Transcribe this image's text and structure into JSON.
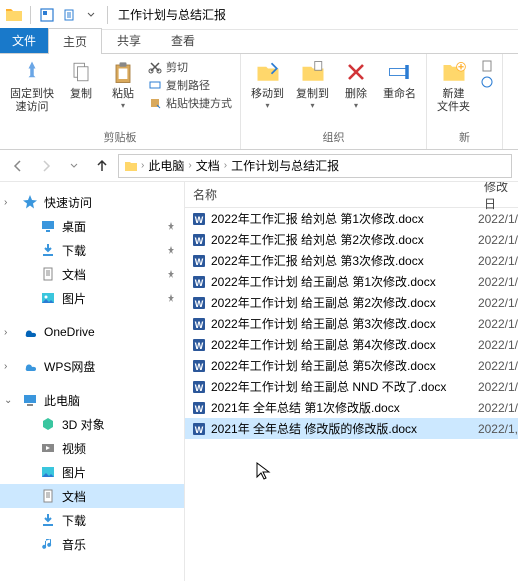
{
  "window": {
    "title": "工作计划与总结汇报"
  },
  "tabs": {
    "file": "文件",
    "home": "主页",
    "share": "共享",
    "view": "查看"
  },
  "ribbon": {
    "pin": "固定到快\n速访问",
    "copy": "复制",
    "paste": "粘贴",
    "cut": "剪切",
    "copy_path": "复制路径",
    "paste_shortcut": "粘贴快捷方式",
    "clipboard_group": "剪贴板",
    "move_to": "移动到",
    "copy_to": "复制到",
    "delete": "删除",
    "rename": "重命名",
    "organize_group": "组织",
    "new_folder": "新建\n文件夹",
    "new_group": "新"
  },
  "breadcrumb": {
    "items": [
      "此电脑",
      "文档",
      "工作计划与总结汇报"
    ]
  },
  "nav": {
    "quick_access": "快速访问",
    "desktop": "桌面",
    "downloads": "下载",
    "documents": "文档",
    "pictures": "图片",
    "onedrive": "OneDrive",
    "wps": "WPS网盘",
    "this_pc": "此电脑",
    "objects_3d": "3D 对象",
    "videos": "视频",
    "pictures2": "图片",
    "documents2": "文档",
    "downloads2": "下载",
    "music": "音乐"
  },
  "columns": {
    "name": "名称",
    "date": "修改日"
  },
  "files": [
    {
      "name": "2022年工作汇报 给刘总 第1次修改.docx",
      "date": "2022/1/"
    },
    {
      "name": "2022年工作汇报 给刘总 第2次修改.docx",
      "date": "2022/1/"
    },
    {
      "name": "2022年工作汇报 给刘总 第3次修改.docx",
      "date": "2022/1/"
    },
    {
      "name": "2022年工作计划 给王副总 第1次修改.docx",
      "date": "2022/1/"
    },
    {
      "name": "2022年工作计划 给王副总 第2次修改.docx",
      "date": "2022/1/"
    },
    {
      "name": "2022年工作计划 给王副总 第3次修改.docx",
      "date": "2022/1/"
    },
    {
      "name": "2022年工作计划 给王副总 第4次修改.docx",
      "date": "2022/1/"
    },
    {
      "name": "2022年工作计划 给王副总 第5次修改.docx",
      "date": "2022/1/"
    },
    {
      "name": "2022年工作计划 给王副总 NND 不改了.docx",
      "date": "2022/1/"
    },
    {
      "name": "2021年 全年总结 第1次修改版.docx",
      "date": "2022/1/"
    },
    {
      "name": "2021年 全年总结 修改版的修改版.docx",
      "date": "2022/1,"
    }
  ],
  "selected_index": 10
}
